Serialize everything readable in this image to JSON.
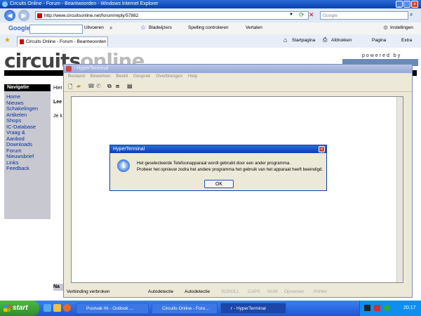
{
  "ie": {
    "title": "Circuits Online - Forum - Beantwoorden - Windows Internet Explorer",
    "url": "http://www.circuitsonline.net/forum/reply/57882",
    "search_placeholder": "Google",
    "google_label": "Google",
    "toolbar": {
      "uitvoeren": "Uitvoeren",
      "bladwijzers": "Bladwijzers",
      "spelling": "Spelling controleren",
      "vertalen": "Vertalen",
      "instellingen": "Instellingen"
    },
    "tab_label": "Circuits Online - Forum - Beantwoorden",
    "cmd": {
      "startpagina": "Startpagina",
      "afdrukken": "Afdrukken",
      "pagina": "Pagina",
      "extra": "Extra"
    }
  },
  "page": {
    "logo_main": "circuits",
    "logo_sub": "online",
    "powered": "powered by",
    "nav_title": "Navigatie",
    "nav_items": [
      "Home",
      "Nieuws",
      "Schakelingen",
      "Artikelen",
      "Shops",
      "IC-Database",
      "Vraag &",
      "Aanbod",
      "Downloads",
      "Forum",
      "Nieuwsbrief",
      "Links",
      "Feedback"
    ],
    "text_hier": "Hier",
    "text_lee": "Lee",
    "text_jek": "Je k",
    "text_na": "Na"
  },
  "hyperterminal": {
    "title": "- HyperTerminal",
    "menu": [
      "Bestand",
      "Bewerken",
      "Beeld",
      "Gesprek",
      "Overbrengen",
      "Help"
    ],
    "status": {
      "connection": "Verbinding verbroken",
      "detect1": "Autodetectie",
      "detect2": "Autodetectie",
      "scroll": "SCROLL",
      "caps": "CAPS",
      "num": "NUM",
      "opnemen": "Opnemen",
      "printer": "Printer"
    }
  },
  "dialog": {
    "title": "HyperTerminal",
    "line1": "Het geselecteerde Telefoonapparaat wordt gebruikt door een ander programma.",
    "line2": "Probeer het opnieuw zodra het andere programma het gebruik van het apparaat heeft beeindigd.",
    "ok": "OK"
  },
  "taskbar": {
    "start": "start",
    "items": [
      "Postvak IN - Outlook ...",
      "Circuits Online - Foru...",
      "r - HyperTerminal"
    ],
    "clock": "20:17"
  }
}
